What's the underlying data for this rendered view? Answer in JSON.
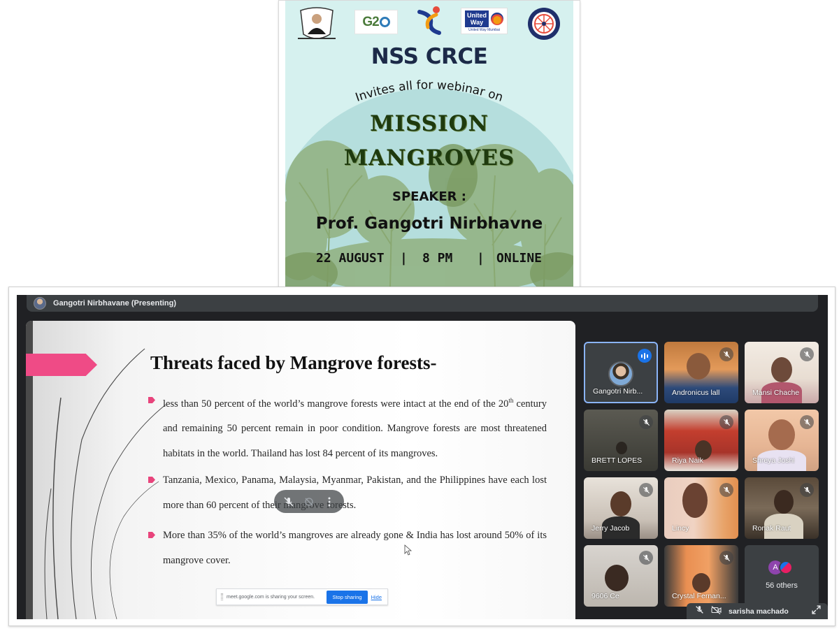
{
  "poster": {
    "logos": [
      "crce-logo",
      "g20-logo",
      "nss-logo",
      "united-way-logo",
      "nss-seal-logo"
    ],
    "g20_text": "G2",
    "united_way_line1": "United",
    "united_way_line2": "Way",
    "united_way_caption": "United Way Mumbai",
    "title": "NSS CRCE",
    "invite_line": "Invites all for webinar on",
    "heading_line1": "MISSION",
    "heading_line2": "MANGROVES",
    "speaker_label": "SPEAKER :",
    "speaker_name": "Prof. Gangotri Nirbhavne",
    "date": "22 AUGUST",
    "separator": "|",
    "time": "8 PM",
    "mode": "ONLINE",
    "colors": {
      "background": "#d6f1ef",
      "hill": "#b5dedd",
      "trees": "#7e9c66",
      "heading": "#1e3a0e"
    }
  },
  "meet": {
    "presenter_label": "Gangotri Nirbhavane (Presenting)",
    "slide": {
      "title": "Threats faced by Mangrove forests-",
      "bullets": [
        {
          "text_pre": "less than 50 percent of the world’s mangrove forests were intact at the end of the 20",
          "sup": "th",
          "text_post": " century and remaining 50 percent remain in poor condition. Mangrove forests are most threatened habitats in the world. Thailand has lost 84 percent of its mangroves."
        },
        {
          "text": "Tanzania, Mexico, Panama, Malaysia, Myanmar, Pakistan, and the Philippines have each lost more than 60 percent of their mangrove forests."
        },
        {
          "text": "More than 35% of the world’s mangroves are already gone  & India has lost around 50% of its mangrove cover."
        }
      ],
      "accent_color": "#ef4b86"
    },
    "share_bar": {
      "message": "meet.google.com is sharing your screen.",
      "stop_label": "Stop sharing",
      "hide_label": "Hide"
    },
    "participants": [
      {
        "name": "Gangotri Nirb...",
        "state": "speaking"
      },
      {
        "name": "Andronicus lall",
        "state": "muted"
      },
      {
        "name": "Mansi Chache",
        "state": "muted"
      },
      {
        "name": "BRETT LOPES",
        "state": "muted"
      },
      {
        "name": "Riya Naik",
        "state": "muted"
      },
      {
        "name": "Shreya Joshi",
        "state": "muted"
      },
      {
        "name": "Jerry Jacob",
        "state": "muted"
      },
      {
        "name": "Lincy",
        "state": "muted"
      },
      {
        "name": "Ronak Raut",
        "state": "muted"
      },
      {
        "name": "9606 Ce",
        "state": "muted"
      },
      {
        "name": "Crystal Fernan...",
        "state": "muted"
      }
    ],
    "others": {
      "avatar_letter": "A",
      "label": "56 others"
    },
    "self": {
      "name": "sarisha machado"
    }
  }
}
